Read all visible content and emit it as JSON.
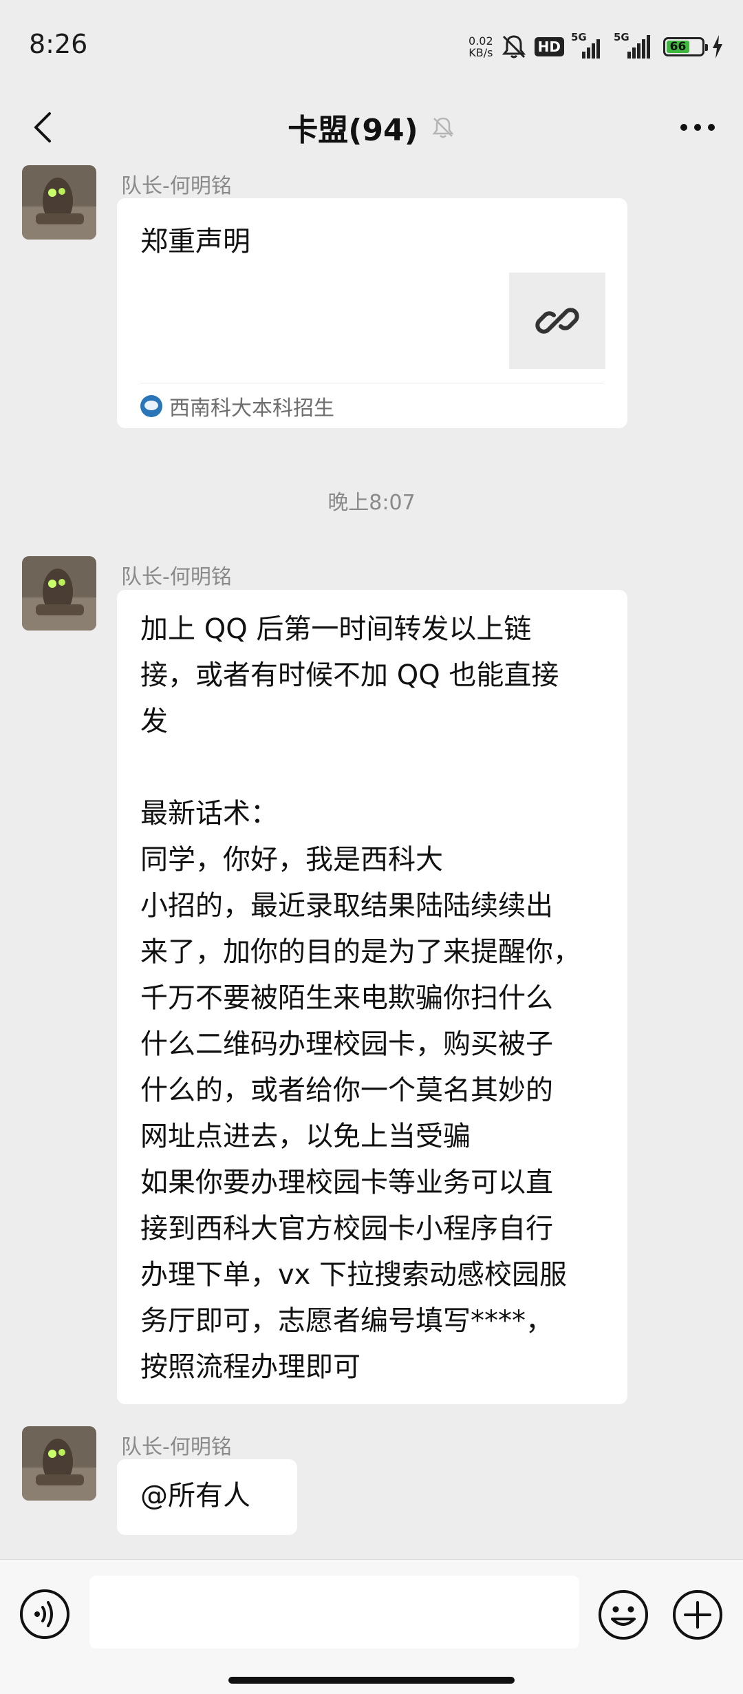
{
  "status_bar": {
    "time": "8:26",
    "net_speed_value": "0.02",
    "net_speed_unit": "KB/s",
    "hd_label": "HD",
    "signal1_label": "5G",
    "signal2_label": "5G",
    "battery_level": "66",
    "charging": true
  },
  "header": {
    "title": "卡盟(94)",
    "muted": true
  },
  "messages": [
    {
      "sender": "队长-何明铭",
      "type": "link",
      "link_title": "郑重声明",
      "link_source": "西南科大本科招生",
      "thumb_icon": "link-icon"
    },
    {
      "type": "timestamp",
      "text": "晚上8:07"
    },
    {
      "sender": "队长-何明铭",
      "type": "text",
      "text": "加上 QQ 后第一时间转发以上链\n接，或者有时候不加 QQ 也能直接\n发\n\n最新话术：\n同学，你好，我是西科大\n小招的，最近录取结果陆陆续续出\n来了，加你的目的是为了来提醒你，\n千万不要被陌生来电欺骗你扫什么\n什么二维码办理校园卡，购买被子\n什么的，或者给你一个莫名其妙的\n网址点进去，以免上当受骗\n如果你要办理校园卡等业务可以直\n接到西科大官方校园卡小程序自行\n办理下单，vx 下拉搜索动感校园服\n务厅即可，志愿者编号填写****，\n按照流程办理即可"
    },
    {
      "sender": "队长-何明铭",
      "type": "text",
      "text": "@所有人"
    }
  ],
  "input_bar": {
    "input_value": "",
    "voice_icon": "voice-icon",
    "emoji_icon": "emoji-icon",
    "plus_icon": "plus-icon"
  }
}
